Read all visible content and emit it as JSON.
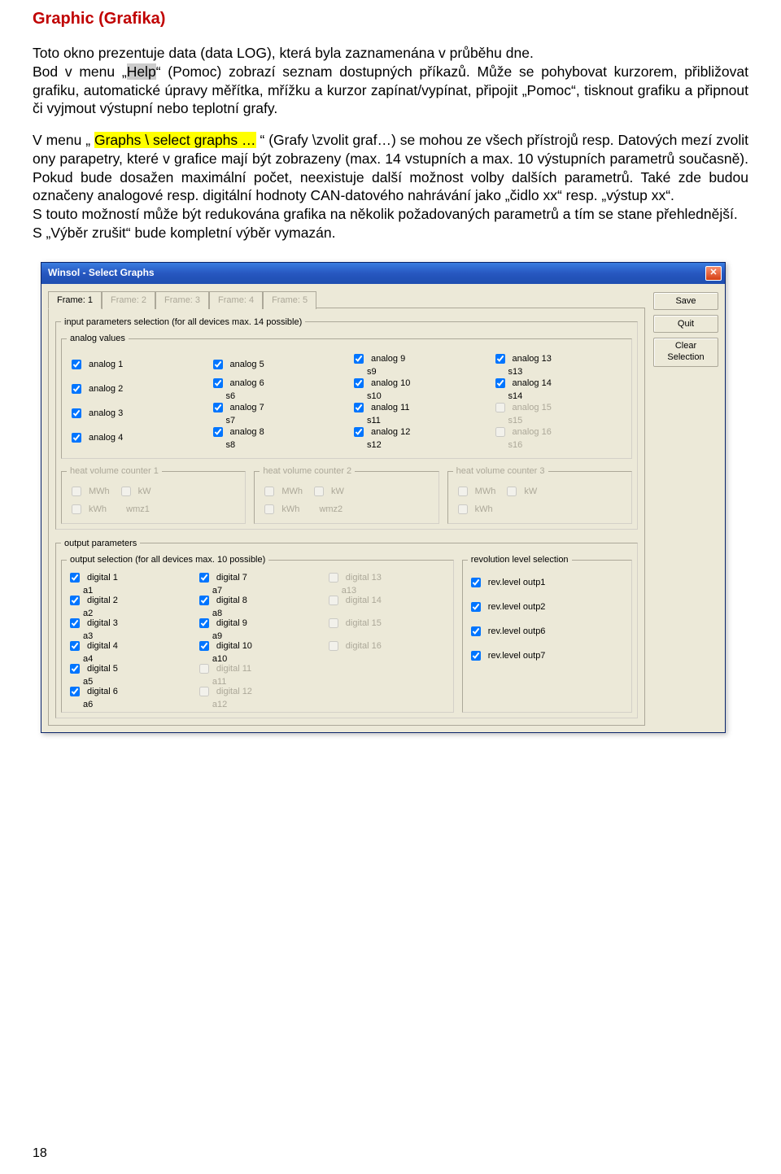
{
  "doc": {
    "title": "Graphic (Grafika)",
    "p1a": "Toto okno prezentuje data (data LOG), která byla zaznamenána v průběhu dne.",
    "p1b_prefix": "Bod v menu „",
    "p1b_hl": "Help",
    "p1b_suffix": "“ (Pomoc) zobrazí seznam dostupných příkazů.",
    "p2": "Může se pohybovat kurzorem, přibližovat grafiku, automatické úpravy měřítka, mřížku a kurzor zapínat/vypínat, připojit „Pomoc“, tisknout grafiku a připnout či vyjmout výstupní nebo teplotní grafy.",
    "p3_prefix": "V menu „ ",
    "p3_hl": "Graphs \\ select graphs …",
    "p3_suffix": " “ (Grafy \\zvolit graf…) se mohou ze všech přístrojů resp. Datových mezí zvolit ony parapetry, které v grafice mají být zobrazeny (max. 14 vstupních a max. 10 výstupních parametrů současně). Pokud bude dosažen maximální počet, neexistuje další možnost volby dalších parametrů. Také zde budou označeny analogové resp. digitální hodnoty CAN-datového nahrávání jako „čidlo xx“ resp. „výstup xx“.",
    "p4": "S touto možností může být redukována grafika na několik požadovaných parametrů a tím se stane přehlednější.",
    "p5": "S „Výběr zrušit“ bude kompletní výběr vymazán.",
    "pgnum": "18"
  },
  "dlg": {
    "title": "Winsol - Select Graphs",
    "tabs": [
      "Frame: 1",
      "Frame: 2",
      "Frame: 3",
      "Frame: 4",
      "Frame: 5"
    ],
    "btn_save": "Save",
    "btn_quit": "Quit",
    "btn_clear": "Clear\nSelection",
    "fs_input": "input parameters selection (for all devices max. 14 possible)",
    "fs_analog": "analog values",
    "fs_hv1": "heat volume counter 1",
    "fs_hv2": "heat volume counter 2",
    "fs_hv3": "heat volume counter 3",
    "fs_output": "output parameters",
    "fs_outsel": "output selection (for all devices max. 10 possible)",
    "fs_rev": "revolution level selection",
    "hv_mwh": "MWh",
    "hv_kw": "kW",
    "hv_kwh": "kWh",
    "hv_sub1": "wmz1",
    "hv_sub2": "wmz2",
    "analog": [
      [
        {
          "label": "analog 1",
          "sub": "",
          "checked": true,
          "enabled": true
        },
        {
          "label": "analog 5",
          "sub": "",
          "checked": true,
          "enabled": true
        },
        {
          "label": "analog 9",
          "sub": "s9",
          "checked": true,
          "enabled": true
        },
        {
          "label": "analog 13",
          "sub": "s13",
          "checked": true,
          "enabled": true
        }
      ],
      [
        {
          "label": "analog 2",
          "sub": "",
          "checked": true,
          "enabled": true
        },
        {
          "label": "analog 6",
          "sub": "s6",
          "checked": true,
          "enabled": true
        },
        {
          "label": "analog 10",
          "sub": "s10",
          "checked": true,
          "enabled": true
        },
        {
          "label": "analog 14",
          "sub": "s14",
          "checked": true,
          "enabled": true
        }
      ],
      [
        {
          "label": "analog 3",
          "sub": "",
          "checked": true,
          "enabled": true
        },
        {
          "label": "analog 7",
          "sub": "s7",
          "checked": true,
          "enabled": true
        },
        {
          "label": "analog 11",
          "sub": "s11",
          "checked": true,
          "enabled": true
        },
        {
          "label": "analog 15",
          "sub": "s15",
          "checked": false,
          "enabled": false
        }
      ],
      [
        {
          "label": "analog 4",
          "sub": "",
          "checked": true,
          "enabled": true
        },
        {
          "label": "analog 8",
          "sub": "s8",
          "checked": true,
          "enabled": true
        },
        {
          "label": "analog 12",
          "sub": "s12",
          "checked": true,
          "enabled": true
        },
        {
          "label": "analog 16",
          "sub": "s16",
          "checked": false,
          "enabled": false
        }
      ]
    ],
    "digital": [
      [
        {
          "label": "digital 1",
          "sub": "a1",
          "checked": true,
          "enabled": true
        },
        {
          "label": "digital 7",
          "sub": "a7",
          "checked": true,
          "enabled": true
        },
        {
          "label": "digital 13",
          "sub": "a13",
          "checked": false,
          "enabled": false
        }
      ],
      [
        {
          "label": "digital 2",
          "sub": "a2",
          "checked": true,
          "enabled": true
        },
        {
          "label": "digital 8",
          "sub": "a8",
          "checked": true,
          "enabled": true
        },
        {
          "label": "digital 14",
          "sub": "",
          "checked": false,
          "enabled": false
        }
      ],
      [
        {
          "label": "digital 3",
          "sub": "a3",
          "checked": true,
          "enabled": true
        },
        {
          "label": "digital 9",
          "sub": "a9",
          "checked": true,
          "enabled": true
        },
        {
          "label": "digital 15",
          "sub": "",
          "checked": false,
          "enabled": false
        }
      ],
      [
        {
          "label": "digital 4",
          "sub": "a4",
          "checked": true,
          "enabled": true
        },
        {
          "label": "digital 10",
          "sub": "a10",
          "checked": true,
          "enabled": true
        },
        {
          "label": "digital 16",
          "sub": "",
          "checked": false,
          "enabled": false
        }
      ],
      [
        {
          "label": "digital 5",
          "sub": "a5",
          "checked": true,
          "enabled": true
        },
        {
          "label": "digital 11",
          "sub": "a11",
          "checked": false,
          "enabled": false
        },
        {
          "label": "",
          "sub": "",
          "checked": false,
          "enabled": false,
          "empty": true
        }
      ],
      [
        {
          "label": "digital 6",
          "sub": "a6",
          "checked": true,
          "enabled": true
        },
        {
          "label": "digital 12",
          "sub": "a12",
          "checked": false,
          "enabled": false
        },
        {
          "label": "",
          "sub": "",
          "checked": false,
          "enabled": false,
          "empty": true
        }
      ]
    ],
    "rev": [
      {
        "label": "rev.level outp1",
        "checked": true
      },
      {
        "label": "rev.level outp2",
        "checked": true
      },
      {
        "label": "rev.level outp6",
        "checked": true
      },
      {
        "label": "rev.level outp7",
        "checked": true
      }
    ]
  }
}
